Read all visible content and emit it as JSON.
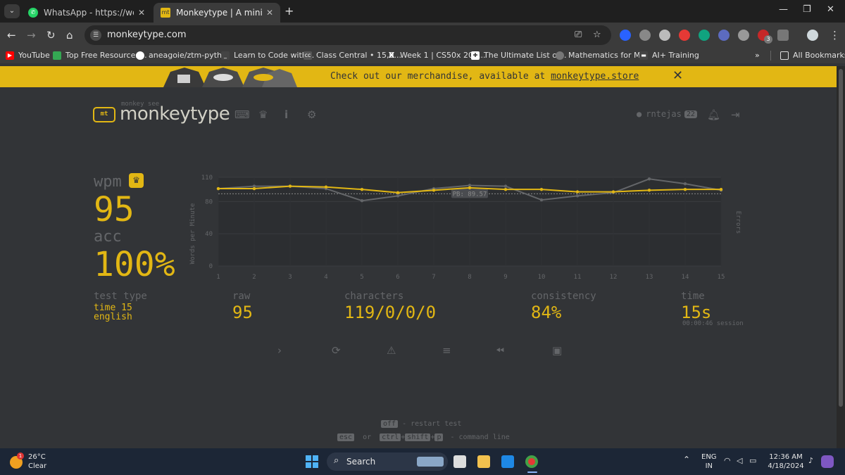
{
  "browser": {
    "tabs": [
      {
        "title": "WhatsApp - https://web.whats",
        "active": false
      },
      {
        "title": "Monkeytype | A minimalistic, c",
        "active": true
      }
    ],
    "url": "monkeytype.com",
    "extension_badge": "3",
    "bookmarks": [
      {
        "label": "YouTube",
        "icon": "youtube-icon",
        "color": "#ff0000"
      },
      {
        "label": "Top Free Resources...",
        "icon": "resources-icon",
        "color": "#34a853"
      },
      {
        "label": "aneagoie/ztm-pyth...",
        "icon": "github-icon",
        "color": "#ffffff"
      },
      {
        "label": "Learn to Code with...",
        "icon": "code-icon",
        "color": "#dddddd"
      },
      {
        "label": "Class Central • 15,0...",
        "icon": "classcentral-icon",
        "color": "#888888"
      },
      {
        "label": "Week 1 | CS50x 202...",
        "icon": "x-icon",
        "color": "#ffffff"
      },
      {
        "label": "The Ultimate List of...",
        "icon": "list-icon",
        "color": "#ffffff"
      },
      {
        "label": "Mathematics for M...",
        "icon": "globe-icon",
        "color": "#dddddd"
      },
      {
        "label": "AI+ Training",
        "icon": "ai-icon",
        "color": "#dddddd"
      }
    ],
    "all_bookmarks": "All Bookmarks"
  },
  "banner": {
    "text": "Check out our merchandise, available at ",
    "link": "monkeytype.store"
  },
  "header": {
    "logo_small": "monkey see",
    "logo_text": "monkeytype",
    "logo_icon_text": "mt",
    "username": "rntejas",
    "level": "22"
  },
  "stats": {
    "wpm_label": "wpm",
    "wpm": "95",
    "acc_label": "acc",
    "acc": "100%",
    "test_type_label": "test type",
    "test_type_1": "time 15",
    "test_type_2": "english",
    "raw_label": "raw",
    "raw": "95",
    "characters_label": "characters",
    "characters": "119/0/0/0",
    "consistency_label": "consistency",
    "consistency": "84%",
    "time_label": "time",
    "time": "15s",
    "session": "00:00:46 session"
  },
  "chart_data": {
    "type": "line",
    "x": [
      1,
      2,
      3,
      4,
      5,
      6,
      7,
      8,
      9,
      10,
      11,
      12,
      13,
      14,
      15
    ],
    "series": [
      {
        "name": "wpm",
        "color": "#e2b714",
        "values": [
          96,
          96,
          99,
          98,
          95,
          91,
          94,
          97,
          95,
          95,
          92,
          92,
          94,
          95,
          95
        ]
      },
      {
        "name": "raw",
        "color": "#646669",
        "values": [
          96,
          99,
          99,
          96,
          81,
          87,
          96,
          100,
          99,
          82,
          87,
          91,
          108,
          102,
          94
        ]
      }
    ],
    "pb": 89.57,
    "pb_label": "PB: 89.57",
    "ylabel": "Words per Minute",
    "y2label": "Errors",
    "yticks": [
      0,
      40,
      80,
      110
    ],
    "ylim": [
      0,
      110
    ]
  },
  "hints": {
    "restart_key": "off",
    "restart_text": "- restart test",
    "cmd_key1": "esc",
    "cmd_or": "or",
    "cmd_key2": "ctrl",
    "cmd_plus1": "+",
    "cmd_key3": "shift",
    "cmd_plus2": "+",
    "cmd_key4": "p",
    "cmd_text": "- command line"
  },
  "taskbar": {
    "temperature": "26°C",
    "weather": "Clear",
    "weather_badge": "1",
    "search": "Search",
    "language": "ENG",
    "region": "IN",
    "time": "12:36 AM",
    "date": "4/18/2024"
  }
}
